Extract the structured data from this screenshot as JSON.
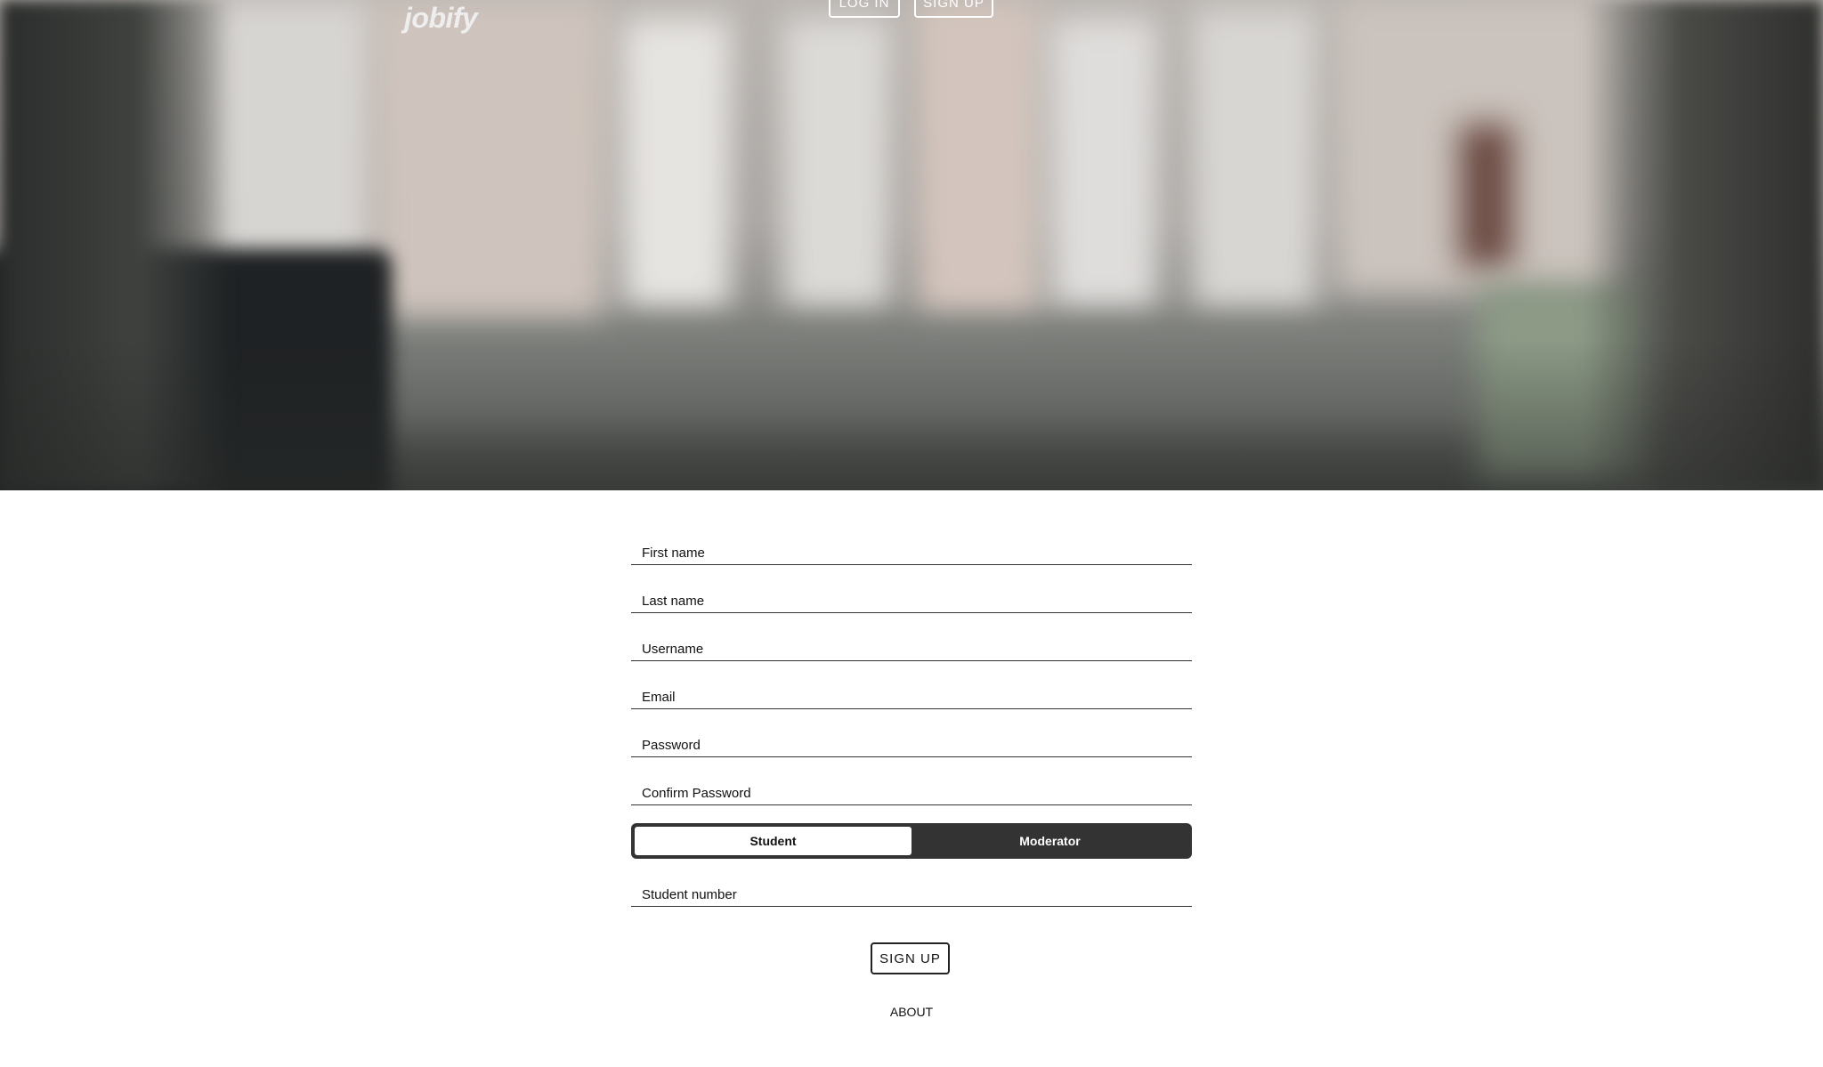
{
  "header": {
    "logo": "jobify",
    "login_label": "LOG IN",
    "signup_label": "SIGN UP"
  },
  "form": {
    "first_name": {
      "placeholder": "First name",
      "value": ""
    },
    "last_name": {
      "placeholder": "Last name",
      "value": ""
    },
    "username": {
      "placeholder": "Username",
      "value": ""
    },
    "email": {
      "placeholder": "Email",
      "value": ""
    },
    "password": {
      "placeholder": "Password",
      "value": ""
    },
    "confirm_password": {
      "placeholder": "Confirm Password",
      "value": ""
    },
    "role_toggle": {
      "options": [
        "Student",
        "Moderator"
      ],
      "selected": "Student"
    },
    "student_number": {
      "placeholder": "Student number",
      "value": ""
    },
    "submit_label": "SIGN UP"
  },
  "footer": {
    "about_label": "ABOUT"
  },
  "colors": {
    "toggle_bg": "#333333",
    "text": "#111111",
    "hero_overlay": "#4d504d"
  }
}
